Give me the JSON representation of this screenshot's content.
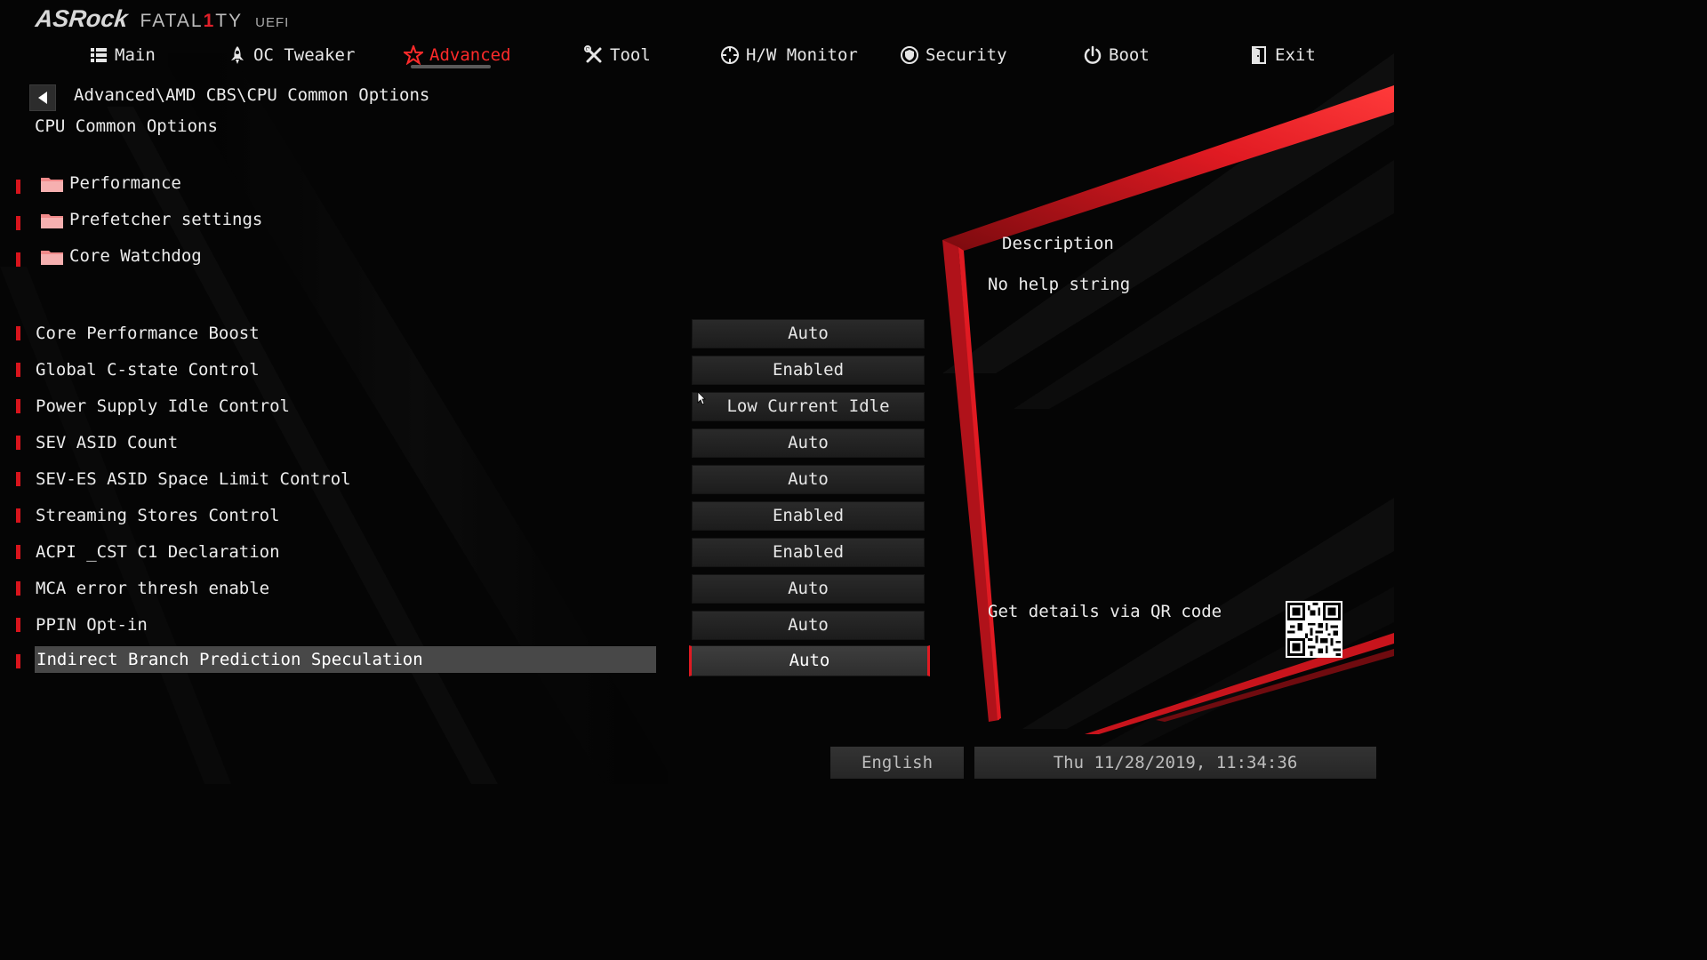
{
  "brand": {
    "logo": "ASRock",
    "fatal_pre": "FATAL",
    "fatal_one": "1",
    "fatal_post": "TY",
    "uefi": "UEFI"
  },
  "nav": {
    "items": [
      {
        "label": "Main",
        "icon": "list-icon"
      },
      {
        "label": "OC Tweaker",
        "icon": "rocket-icon"
      },
      {
        "label": "Advanced",
        "icon": "star-icon",
        "active": true
      },
      {
        "label": "Tool",
        "icon": "tools-icon"
      },
      {
        "label": "H/W Monitor",
        "icon": "crosshair-icon"
      },
      {
        "label": "Security",
        "icon": "shield-icon"
      },
      {
        "label": "Boot",
        "icon": "power-icon"
      },
      {
        "label": "Exit",
        "icon": "exit-door-icon"
      }
    ]
  },
  "breadcrumb": "Advanced\\AMD CBS\\CPU Common Options",
  "page_title": "CPU Common Options",
  "submenus": [
    {
      "label": "Performance"
    },
    {
      "label": "Prefetcher settings"
    },
    {
      "label": "Core Watchdog"
    }
  ],
  "options": [
    {
      "label": "Core Performance Boost",
      "value": "Auto"
    },
    {
      "label": "Global C-state Control",
      "value": "Enabled"
    },
    {
      "label": "Power Supply Idle Control",
      "value": "Low Current Idle"
    },
    {
      "label": "SEV ASID Count",
      "value": "Auto"
    },
    {
      "label": "SEV-ES ASID Space Limit Control",
      "value": "Auto"
    },
    {
      "label": "Streaming Stores Control",
      "value": "Enabled"
    },
    {
      "label": "ACPI _CST C1 Declaration",
      "value": "Enabled"
    },
    {
      "label": "MCA error thresh enable",
      "value": "Auto"
    },
    {
      "label": "PPIN Opt-in",
      "value": "Auto"
    },
    {
      "label": "Indirect Branch Prediction Speculation",
      "value": "Auto",
      "selected": true
    }
  ],
  "description": {
    "title": "Description",
    "body": "No help string",
    "qr_label": "Get details via QR code"
  },
  "footer": {
    "language": "English",
    "datetime": "Thu 11/28/2019, 11:34:36"
  },
  "colors": {
    "accent": "#e01a22",
    "background": "#050505",
    "text": "#ececec",
    "selected_row": "#484848"
  }
}
